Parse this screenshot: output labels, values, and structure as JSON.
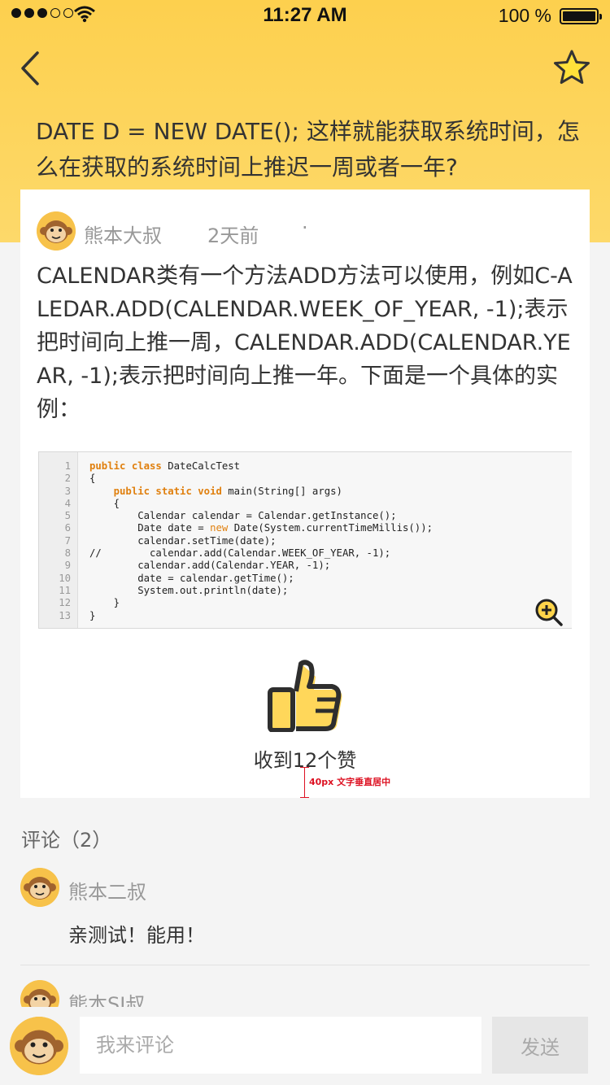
{
  "status_bar": {
    "time": "11:27 AM",
    "battery": "100 %"
  },
  "nav": {
    "back_icon": "chevron-left-icon",
    "favorite_icon": "star-icon"
  },
  "question": {
    "title": "DATE D = NEW DATE(); 这样就能获取系统时间，怎么在获取的系统时间上推迟一周或者一年?"
  },
  "answer": {
    "author": "熊本大叔",
    "time": "2天前",
    "separator": "·",
    "text": "CALENDAR类有一个方法ADD方法可以使用，例如C-ALEDAR.ADD(CALENDAR.WEEK_OF_YEAR, -1);表示把时间向上推一周，CALENDAR.ADD(CALENDAR.YEAR, -1);表示把时间向上推一年。下面是一个具体的实例：",
    "code_line_numbers": [
      "1",
      "2",
      "3",
      "4",
      "5",
      "6",
      "7",
      "8",
      "9",
      "10",
      "11",
      "12",
      "13"
    ],
    "code": {
      "l1a": "public class",
      "l1b": " DateCalcTest",
      "l2": "{",
      "l3a": "    public static void",
      "l3b": " main(String[] args)",
      "l4": "    {",
      "l5": "        Calendar calendar = Calendar.getInstance();",
      "l6a": "        Date date = ",
      "l6b": "new",
      "l6c": " Date(System.currentTimeMillis());",
      "l7": "        calendar.setTime(date);",
      "l8": "//        calendar.add(Calendar.WEEK_OF_YEAR, -1);",
      "l9": "        calendar.add(Calendar.YEAR, -1);",
      "l10": "        date = calendar.getTime();",
      "l11": "        System.out.println(date);",
      "l12": "    }",
      "l13": "}"
    },
    "zoom_icon": "zoom-in-icon",
    "like_icon": "thumbs-up-icon",
    "likes_text": "收到12个赞",
    "annotation": "40px 文字垂直居中"
  },
  "comments": {
    "title": "评论（2）",
    "items": [
      {
        "author": "熊本二叔",
        "text": "亲测试！能用！"
      },
      {
        "author": "熊本SI叔",
        "text": ""
      }
    ]
  },
  "composer": {
    "placeholder": "我来评论",
    "send_label": "发送"
  },
  "colors": {
    "accent": "#fdd04e",
    "background": "#f4f4f4"
  }
}
